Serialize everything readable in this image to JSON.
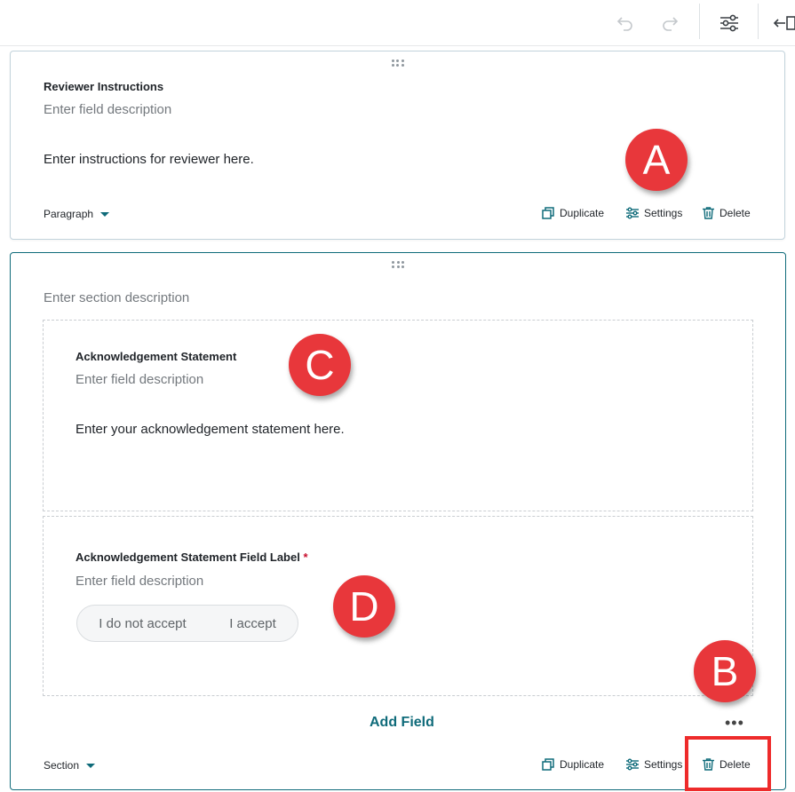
{
  "toolbar": {
    "icons": [
      "undo-icon",
      "redo-icon",
      "filter-settings-icon",
      "collapse-panel-icon"
    ]
  },
  "reviewer_card": {
    "label": "Reviewer Instructions",
    "description_placeholder": "Enter field description",
    "body": "Enter instructions for reviewer here.",
    "type": "Paragraph",
    "actions": {
      "duplicate": "Duplicate",
      "settings": "Settings",
      "delete": "Delete"
    }
  },
  "section_card": {
    "description_placeholder": "Enter section description",
    "ack_field": {
      "label": "Acknowledgement Statement",
      "description_placeholder": "Enter field description",
      "body": "Enter your acknowledgement statement here."
    },
    "ack_label_field": {
      "label": "Acknowledgement Statement Field Label",
      "required_mark": "*",
      "description_placeholder": "Enter field description",
      "options": [
        "I do not accept",
        "I accept"
      ]
    },
    "add_field": "Add Field",
    "more": "•••",
    "type": "Section",
    "actions": {
      "duplicate": "Duplicate",
      "settings": "Settings",
      "delete": "Delete"
    }
  },
  "markers": {
    "a": "A",
    "b": "B",
    "c": "C",
    "d": "D"
  },
  "colors": {
    "accent": "#0f6b7a",
    "marker": "#e8373b",
    "highlight": "#ee2b2b"
  }
}
